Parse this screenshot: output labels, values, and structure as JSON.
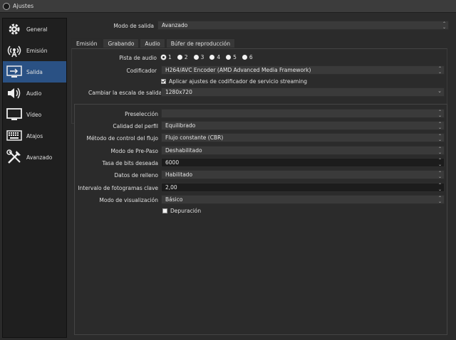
{
  "window": {
    "title": "Ajustes"
  },
  "sidebar": {
    "items": [
      {
        "label": "General",
        "icon": "gear-icon"
      },
      {
        "label": "Emisión",
        "icon": "broadcast-icon"
      },
      {
        "label": "Salida",
        "icon": "output-icon",
        "active": true
      },
      {
        "label": "Audio",
        "icon": "speaker-icon"
      },
      {
        "label": "Vídeo",
        "icon": "monitor-icon"
      },
      {
        "label": "Atajos",
        "icon": "keyboard-icon"
      },
      {
        "label": "Avanzado",
        "icon": "tools-icon"
      }
    ]
  },
  "output_mode": {
    "label": "Modo de salida",
    "value": "Avanzado"
  },
  "tabs": [
    {
      "label": "Emisión",
      "active": true
    },
    {
      "label": "Grabando"
    },
    {
      "label": "Audio"
    },
    {
      "label": "Búfer de reproducción"
    }
  ],
  "audio_track": {
    "label": "Pista de audio",
    "options": [
      "1",
      "2",
      "3",
      "4",
      "5",
      "6"
    ],
    "selected": "1"
  },
  "encoder": {
    "label": "Codificador",
    "value": "H264/AVC Encoder (AMD Advanced Media Framework)"
  },
  "apply_streaming": {
    "label": "Aplicar ajustes de codificador de servicio streaming",
    "checked": true
  },
  "rescale": {
    "label": "Cambiar la escala de salida",
    "checked": true,
    "value": "1280x720"
  },
  "settings": {
    "preset": {
      "label": "Preselección",
      "value": ""
    },
    "profile_quality": {
      "label": "Calidad del perfil",
      "value": "Equilibrado"
    },
    "rate_control": {
      "label": "Método de control del flujo",
      "value": "Flujo constante (CBR)"
    },
    "prepass": {
      "label": "Modo de Pre-Paso",
      "value": "Deshabilitado"
    },
    "bitrate": {
      "label": "Tasa de bits deseada",
      "value": "6000"
    },
    "filler": {
      "label": "Datos de relleno",
      "value": "Habilitado"
    },
    "keyframe": {
      "label": "Intervalo de fotogramas clave",
      "value": "2,00"
    },
    "view_mode": {
      "label": "Modo de visualización",
      "value": "Básico"
    },
    "debug": {
      "label": "Depuración",
      "checked": false
    }
  },
  "colors": {
    "accent": "#2a5184",
    "background": "#2b2b2b",
    "sidebar": "#1f1f1f"
  }
}
